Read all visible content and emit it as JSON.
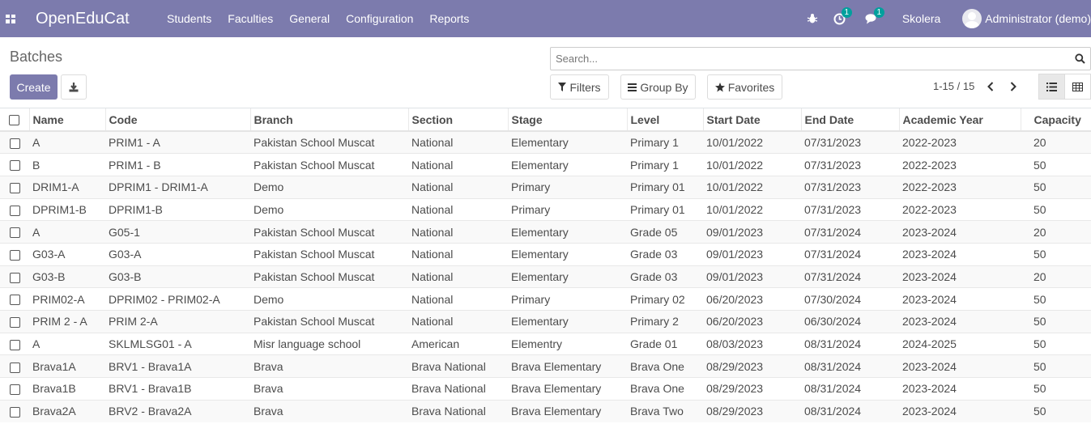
{
  "navbar": {
    "brand": "OpenEduCat",
    "menu": [
      "Students",
      "Faculties",
      "General",
      "Configuration",
      "Reports"
    ],
    "activity_count": "1",
    "messages_count": "1",
    "company": "Skolera",
    "user": "Administrator (demo)"
  },
  "page": {
    "title": "Batches",
    "create_label": "Create",
    "search_placeholder": "Search...",
    "filters_label": "Filters",
    "groupby_label": "Group By",
    "favorites_label": "Favorites",
    "pager": "1-15 / 15"
  },
  "colors": {
    "navbar": "#7c7bad",
    "primary_button": "#7c7bad",
    "badge": "#00a09d"
  },
  "table": {
    "columns": [
      "Name",
      "Code",
      "Branch",
      "Section",
      "Stage",
      "Level",
      "Start Date",
      "End Date",
      "Academic Year",
      "Capacity"
    ],
    "rows": [
      [
        "A",
        "PRIM1 - A",
        "Pakistan School Muscat",
        "National",
        "Elementary",
        "Primary 1",
        "10/01/2022",
        "07/31/2023",
        "2022-2023",
        "20"
      ],
      [
        "B",
        "PRIM1 - B",
        "Pakistan School Muscat",
        "National",
        "Elementary",
        "Primary 1",
        "10/01/2022",
        "07/31/2023",
        "2022-2023",
        "50"
      ],
      [
        "DRIM1-A",
        "DPRIM1 - DRIM1-A",
        "Demo",
        "National",
        "Primary",
        "Primary 01",
        "10/01/2022",
        "07/31/2023",
        "2022-2023",
        "50"
      ],
      [
        "DPRIM1-B",
        "DPRIM1-B",
        "Demo",
        "National",
        "Primary",
        "Primary 01",
        "10/01/2022",
        "07/31/2023",
        "2022-2023",
        "50"
      ],
      [
        "A",
        "G05-1",
        "Pakistan School Muscat",
        "National",
        "Elementary",
        "Grade 05",
        "09/01/2023",
        "07/31/2024",
        "2023-2024",
        "20"
      ],
      [
        "G03-A",
        "G03-A",
        "Pakistan School Muscat",
        "National",
        "Elementary",
        "Grade 03",
        "09/01/2023",
        "07/31/2024",
        "2023-2024",
        "50"
      ],
      [
        "G03-B",
        "G03-B",
        "Pakistan School Muscat",
        "National",
        "Elementary",
        "Grade 03",
        "09/01/2023",
        "07/31/2024",
        "2023-2024",
        "20"
      ],
      [
        "PRIM02-A",
        "DPRIM02 - PRIM02-A",
        "Demo",
        "National",
        "Primary",
        "Primary 02",
        "06/20/2023",
        "07/30/2024",
        "2023-2024",
        "50"
      ],
      [
        "PRIM 2 - A",
        "PRIM 2-A",
        "Pakistan School Muscat",
        "National",
        "Elementary",
        "Primary 2",
        "06/20/2023",
        "06/30/2024",
        "2023-2024",
        "50"
      ],
      [
        "A",
        "SKLMLSG01 - A",
        "Misr language school",
        "American",
        "Elementry",
        "Grade 01",
        "08/03/2023",
        "08/31/2024",
        "2024-2025",
        "50"
      ],
      [
        "Brava1A",
        "BRV1 - Brava1A",
        "Brava",
        "Brava National",
        "Brava Elementary",
        "Brava One",
        "08/29/2023",
        "08/31/2024",
        "2023-2024",
        "50"
      ],
      [
        "Brava1B",
        "BRV1 - Brava1B",
        "Brava",
        "Brava National",
        "Brava Elementary",
        "Brava One",
        "08/29/2023",
        "08/31/2024",
        "2023-2024",
        "50"
      ],
      [
        "Brava2A",
        "BRV2 - Brava2A",
        "Brava",
        "Brava National",
        "Brava Elementary",
        "Brava Two",
        "08/29/2023",
        "08/31/2024",
        "2023-2024",
        "50"
      ]
    ]
  }
}
